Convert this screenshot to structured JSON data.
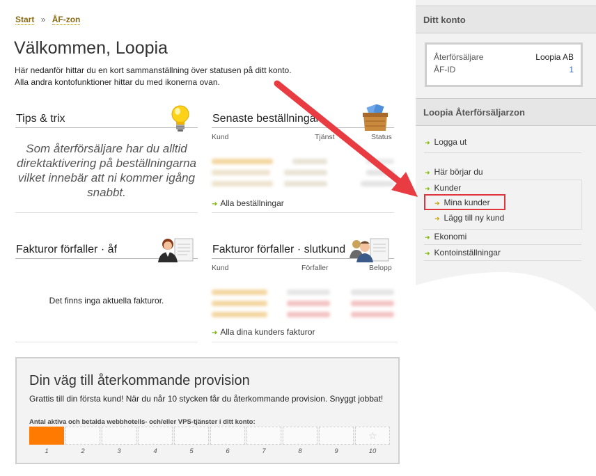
{
  "breadcrumb": {
    "start": "Start",
    "separator": "»",
    "current": "ÅF-zon"
  },
  "page": {
    "title": "Välkommen, Loopia",
    "intro_line1": "Här nedanför hittar du en kort sammanställning över statusen på ditt konto.",
    "intro_line2": "Alla andra kontofunktioner hittar du med ikonerna ovan."
  },
  "tips": {
    "title": "Tips & trix",
    "text": "Som återförsäljare har du alltid direktaktivering på beställningarna vilket innebär att ni kommer igång snabbt."
  },
  "orders": {
    "title": "Senaste beställningar",
    "columns": [
      "Kund",
      "Tjänst",
      "Status"
    ],
    "link": "Alla beställningar"
  },
  "invoices_af": {
    "title": "Fakturor förfaller · åf",
    "empty": "Det finns inga aktuella fakturor."
  },
  "invoices_customers": {
    "title": "Fakturor förfaller · slutkund",
    "columns": [
      "Kund",
      "Förfaller",
      "Belopp"
    ],
    "link": "Alla dina kunders fakturor"
  },
  "provision": {
    "title": "Din väg till återkommande provision",
    "subtitle": "Grattis till din första kund! När du når 10 stycken får du återkommande provision. Snyggt jobbat!",
    "label": "Antal aktiva och betalda webbhotells- och/eller VPS-tjänster i ditt konto:",
    "steps": [
      "1",
      "2",
      "3",
      "4",
      "5",
      "6",
      "7",
      "8",
      "9",
      "10"
    ],
    "filled_count": 1,
    "goal_icon": "star-icon"
  },
  "sidebar": {
    "account_title": "Ditt konto",
    "reseller_label": "Återförsäljare",
    "reseller_value": "Loopia AB",
    "af_id_label": "ÅF-ID",
    "af_id_value": "1",
    "zone_title": "Loopia Återförsäljarzon",
    "nav": {
      "logout": "Logga ut",
      "start_here": "Här börjar du",
      "customers": "Kunder",
      "my_customers": "Mina kunder",
      "add_customer": "Lägg till ny kund",
      "economy": "Ekonomi",
      "account_settings": "Kontoinställningar"
    }
  },
  "colors": {
    "accent_orange": "#ff7a00",
    "link_arrow": "#7cb800",
    "highlight": "#e0353c",
    "crumb": "#8a6a12"
  }
}
